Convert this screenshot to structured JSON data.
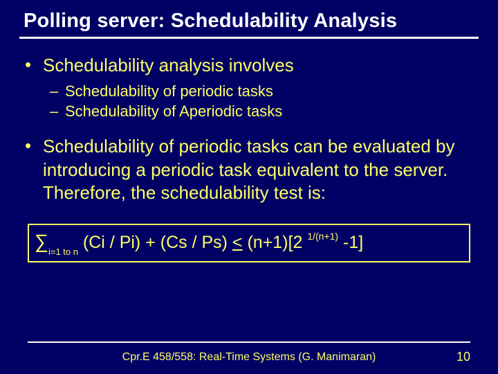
{
  "title": "Polling server: Schedulability Analysis",
  "b1": "Schedulability analysis involves",
  "b1a": "Schedulability of  periodic tasks",
  "b1b": "Schedulability of Aperiodic tasks",
  "b2": "Schedulability of periodic tasks can be evaluated by introducing a periodic task equivalent to the server. Therefore, the schedulability test is:",
  "formula": {
    "sum_sub": "i=1 to n",
    "part1": " (Ci / Pi) + (Cs / Ps) ",
    "le": "<",
    "part2": " (n+1)[2 ",
    "exp": "1/(n+1)",
    "part3": " -1]"
  },
  "footer": {
    "course": "Cpr.E 458/558: Real-Time Systems (G. Manimaran)",
    "page": "10"
  }
}
